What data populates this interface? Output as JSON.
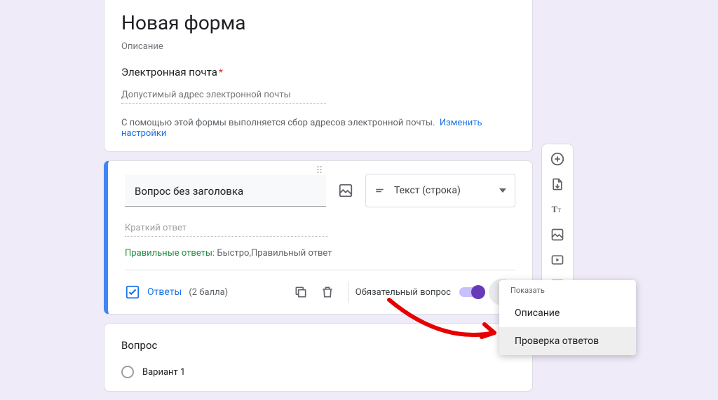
{
  "header": {
    "title": "Новая форма",
    "description": "Описание",
    "email_label": "Электронная почта",
    "email_placeholder": "Допустимый адрес электронной почты",
    "collect_note": "С помощью этой формы выполняется сбор адресов электронной почты.",
    "change_settings": "Изменить настройки"
  },
  "question": {
    "title": "Вопрос без заголовка",
    "type_label": "Текст (строка)",
    "short_answer": "Краткий ответ",
    "correct_label": "Правильные ответы:",
    "correct_values": "Быстро,Правильный ответ",
    "answer_key": "Ответы",
    "points": "(2 балла)",
    "required_label": "Обязательный вопрос"
  },
  "question3": {
    "title": "Вопрос",
    "option1": "Вариант 1"
  },
  "popover": {
    "header": "Показать",
    "item_desc": "Описание",
    "item_validate": "Проверка ответов"
  }
}
